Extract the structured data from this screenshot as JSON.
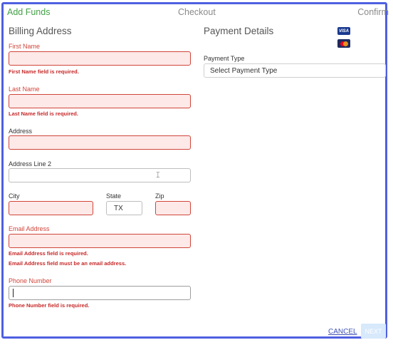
{
  "steps": {
    "add_funds": "Add Funds",
    "checkout": "Checkout",
    "confirm": "Confirm"
  },
  "billing": {
    "title": "Billing Address",
    "first_name": {
      "label": "First Name",
      "value": "",
      "error": "First Name field is required."
    },
    "last_name": {
      "label": "Last Name",
      "value": "",
      "error": "Last Name field is required."
    },
    "address": {
      "label": "Address",
      "value": ""
    },
    "address_line2": {
      "label": "Address Line 2",
      "value": ""
    },
    "city": {
      "label": "City",
      "value": ""
    },
    "state": {
      "label": "State",
      "value": "TX"
    },
    "zip": {
      "label": "Zip",
      "value": ""
    },
    "email": {
      "label": "Email Address",
      "value": "",
      "errors": [
        "Email Address field is required.",
        "Email Address field must be an email address."
      ]
    },
    "phone": {
      "label": "Phone Number",
      "value": "",
      "error": "Phone Number field is required."
    }
  },
  "payment": {
    "title": "Payment Details",
    "cards": {
      "visa_text": "VISA",
      "visa_icon": "visa-card-icon",
      "mastercard_icon": "mastercard-icon"
    },
    "type_label": "Payment Type",
    "type_value": "Select Payment Type"
  },
  "actions": {
    "cancel": "CANCEL",
    "next": "NEXT"
  },
  "colors": {
    "frame": "#4f5fe0",
    "active_step": "#43a047",
    "error": "#d0453a",
    "error_bg": "#fde9e8",
    "link": "#3f51b5"
  }
}
